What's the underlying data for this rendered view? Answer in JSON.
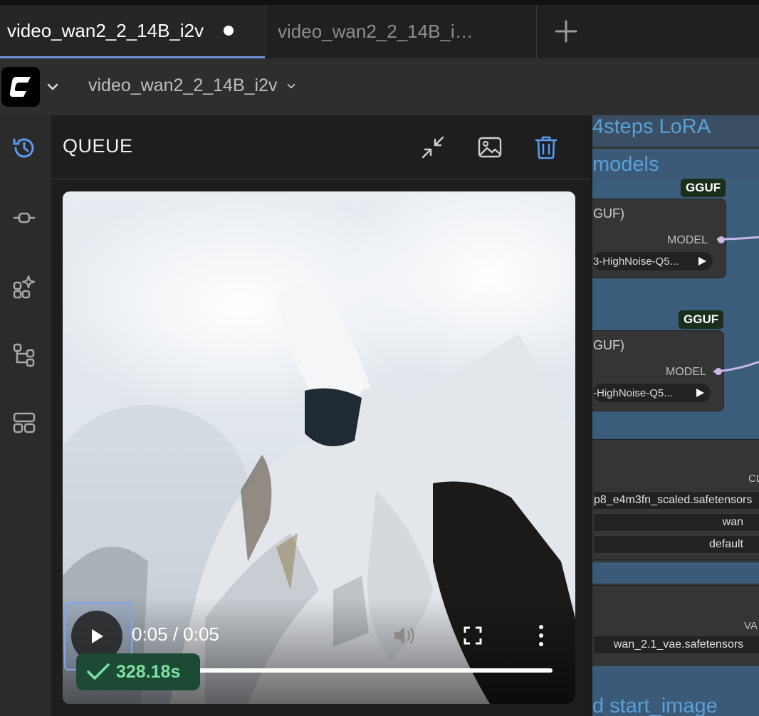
{
  "tabs": [
    {
      "label": "video_wan2_2_14B_i2v",
      "active": true,
      "unsaved": true
    },
    {
      "label": "video_wan2_2_14B_i…",
      "active": false
    }
  ],
  "toolbar": {
    "workflow_name": "video_wan2_2_14B_i2v"
  },
  "sidebar": {
    "items": [
      {
        "icon": "history-icon",
        "active": true
      },
      {
        "icon": "node-library-icon"
      },
      {
        "icon": "model-library-icon"
      },
      {
        "icon": "workflows-icon"
      },
      {
        "icon": "templates-icon"
      }
    ]
  },
  "queue": {
    "title": "QUEUE",
    "video": {
      "time": "0:05 / 0:05",
      "progress": 1.0
    },
    "badge": {
      "duration": "328.18s"
    }
  },
  "canvas": {
    "groups": [
      {
        "title": "4steps LoRA"
      },
      {
        "title": "models"
      }
    ],
    "nodes": [
      {
        "badge": "GGUF",
        "title_fragment": "GUF)",
        "output": "MODEL",
        "value": "3-HighNoise-Q5..."
      },
      {
        "badge": "GGUF",
        "title_fragment": "GUF)",
        "output": "MODEL",
        "value": "-HighNoise-Q5..."
      }
    ],
    "clip_label": "CL",
    "clip_fields": [
      "p8_e4m3fn_scaled.safetensors",
      "wan",
      "default"
    ],
    "vae_label": "VA",
    "vae_field": "wan_2.1_vae.safetensors",
    "bottom_group": "d start_image"
  },
  "colors": {
    "accent": "#6b8fd6",
    "success": "#7ee0a4",
    "group_title": "#5aa0d8",
    "link": "#c9b7e8"
  }
}
